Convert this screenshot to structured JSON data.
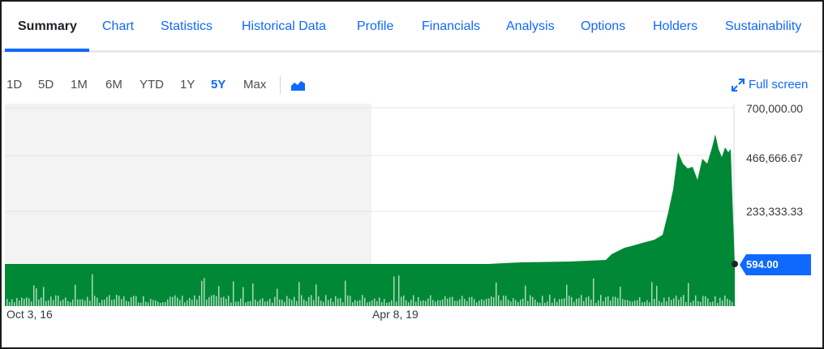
{
  "tabs": [
    {
      "label": "Summary",
      "active": true
    },
    {
      "label": "Chart"
    },
    {
      "label": "Statistics"
    },
    {
      "label": "Historical Data"
    },
    {
      "label": "Profile"
    },
    {
      "label": "Financials"
    },
    {
      "label": "Analysis"
    },
    {
      "label": "Options"
    },
    {
      "label": "Holders"
    },
    {
      "label": "Sustainability"
    }
  ],
  "ranges": [
    {
      "label": "1D"
    },
    {
      "label": "5D"
    },
    {
      "label": "1M"
    },
    {
      "label": "6M"
    },
    {
      "label": "YTD"
    },
    {
      "label": "1Y"
    },
    {
      "label": "5Y",
      "active": true
    },
    {
      "label": "Max"
    }
  ],
  "fullscreen_label": "Full screen",
  "icons": {
    "chart_type": "area-chart-icon",
    "fullscreen": "expand-arrows-icon"
  },
  "colors": {
    "accent": "#0f69ff",
    "area_fill": "#008836",
    "shaded_region": "#f3f3f3",
    "price_tag": "#0f69ff"
  },
  "chart_data": {
    "type": "area",
    "y_ticks": [
      "700,000.00",
      "466,666.67",
      "233,333.33"
    ],
    "ylim": [
      0,
      700000
    ],
    "x_ticks": [
      "Oct 3, 16",
      "Apr 8, 19"
    ],
    "current_price": "594.00",
    "series_shape": "flat for most of the period, rising sharply near the end to about 590,000 then dropping to 594.00",
    "volume": "bars along the bottom",
    "grid": true
  }
}
